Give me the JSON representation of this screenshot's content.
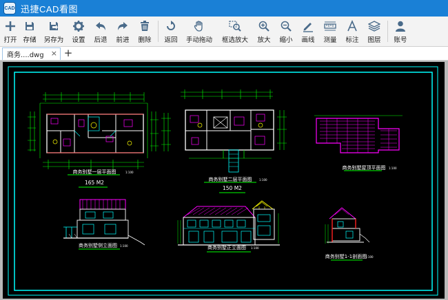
{
  "app": {
    "title": "迅捷CAD看图",
    "logo_text": "CAD"
  },
  "toolbar": {
    "buttons": [
      {
        "label": "打开",
        "icon": "plus-icon"
      },
      {
        "label": "存储",
        "icon": "save-icon"
      },
      {
        "label": "另存为",
        "icon": "save-as-icon"
      },
      {
        "label": "设置",
        "icon": "gear-icon"
      },
      {
        "label": "后退",
        "icon": "undo-icon"
      },
      {
        "label": "前进",
        "icon": "redo-icon"
      },
      {
        "label": "删除",
        "icon": "trash-icon"
      },
      {
        "label": "返回",
        "icon": "return-icon"
      },
      {
        "label": "手动拖动",
        "icon": "hand-icon"
      },
      {
        "label": "框选放大",
        "icon": "zoom-window-icon"
      },
      {
        "label": "放大",
        "icon": "zoom-in-icon"
      },
      {
        "label": "缩小",
        "icon": "zoom-out-icon"
      },
      {
        "label": "画线",
        "icon": "pencil-icon"
      },
      {
        "label": "测量",
        "icon": "ruler-icon"
      },
      {
        "label": "标注",
        "icon": "text-icon"
      },
      {
        "label": "图层",
        "icon": "layers-icon"
      },
      {
        "label": "账号",
        "icon": "user-icon"
      }
    ]
  },
  "tabs": {
    "active_tab": "商务....dwg",
    "close_glyph": "×",
    "add_glyph": "+"
  },
  "drawing": {
    "plan1_title": "商务别墅一层平面图",
    "plan1_scale": "1:100",
    "plan1_area": "165 M2",
    "plan2_title": "商务别墅二层平面图",
    "plan2_scale": "1:100",
    "plan2_area": "150 M2",
    "roof_title": "商务别墅屋顶平面图",
    "roof_scale": "1:100",
    "side_title": "商务别墅侧立面图",
    "side_scale": "1:100",
    "front_title": "商务别墅正立面图",
    "front_scale": "1:100",
    "section_title": "商务别墅1-1剖面图",
    "section_scale": "1:100"
  },
  "colors": {
    "titlebar": "#1a80d6",
    "toolbar_icon": "#4a6b8a",
    "canvas": "#000000",
    "cad_green": "#00ff00",
    "cad_cyan": "#00ffff",
    "cad_magenta": "#ff00ff",
    "cad_red": "#ff2020",
    "cad_yellow": "#ffff00"
  }
}
